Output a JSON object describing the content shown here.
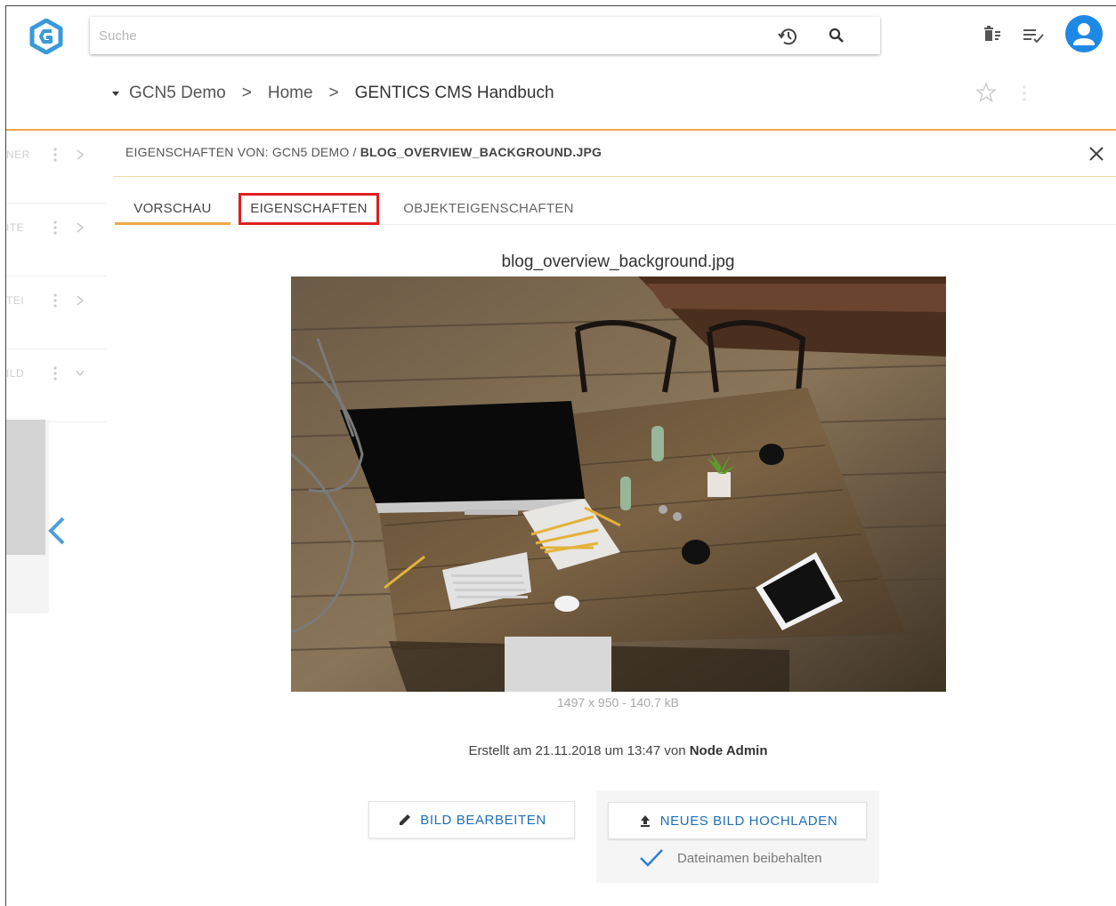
{
  "header": {
    "search_placeholder": "Suche",
    "icons": [
      "history-icon",
      "search-icon",
      "wastebin-icon",
      "tasklist-icon",
      "user-icon"
    ],
    "accent_color": "#1e88e5"
  },
  "breadcrumb": {
    "items": [
      "GCN5 Demo",
      "Home",
      "GENTICS CMS Handbuch"
    ],
    "separator": ">"
  },
  "left_list": {
    "items": [
      {
        "label": "NER"
      },
      {
        "label": "ITE"
      },
      {
        "label": "TEI"
      },
      {
        "label": "ILD"
      }
    ]
  },
  "properties": {
    "title_prefix": "EIGENSCHAFTEN VON:",
    "title_path": "GCN5 DEMO /",
    "title_file": "BLOG_OVERVIEW_BACKGROUND.JPG",
    "tabs": [
      {
        "label": "VORSCHAU",
        "active": true
      },
      {
        "label": "EIGENSCHAFTEN",
        "highlighted": true
      },
      {
        "label": "OBJEKTEIGENSCHAFTEN"
      }
    ],
    "filename": "blog_overview_background.jpg",
    "dimensions": "1497 x 950 - 140.7 kB",
    "created_prefix": "Erstellt am 21.11.2018 um 13:47 von",
    "created_by": "Node Admin",
    "edit_button": "BILD BEARBEITEN",
    "upload_button": "NEUES BILD HOCHLADEN",
    "keep_filename": "Dateinamen beibehalten",
    "highlight_color": "#e01f1f",
    "tab_accent_color": "#f0a847"
  }
}
